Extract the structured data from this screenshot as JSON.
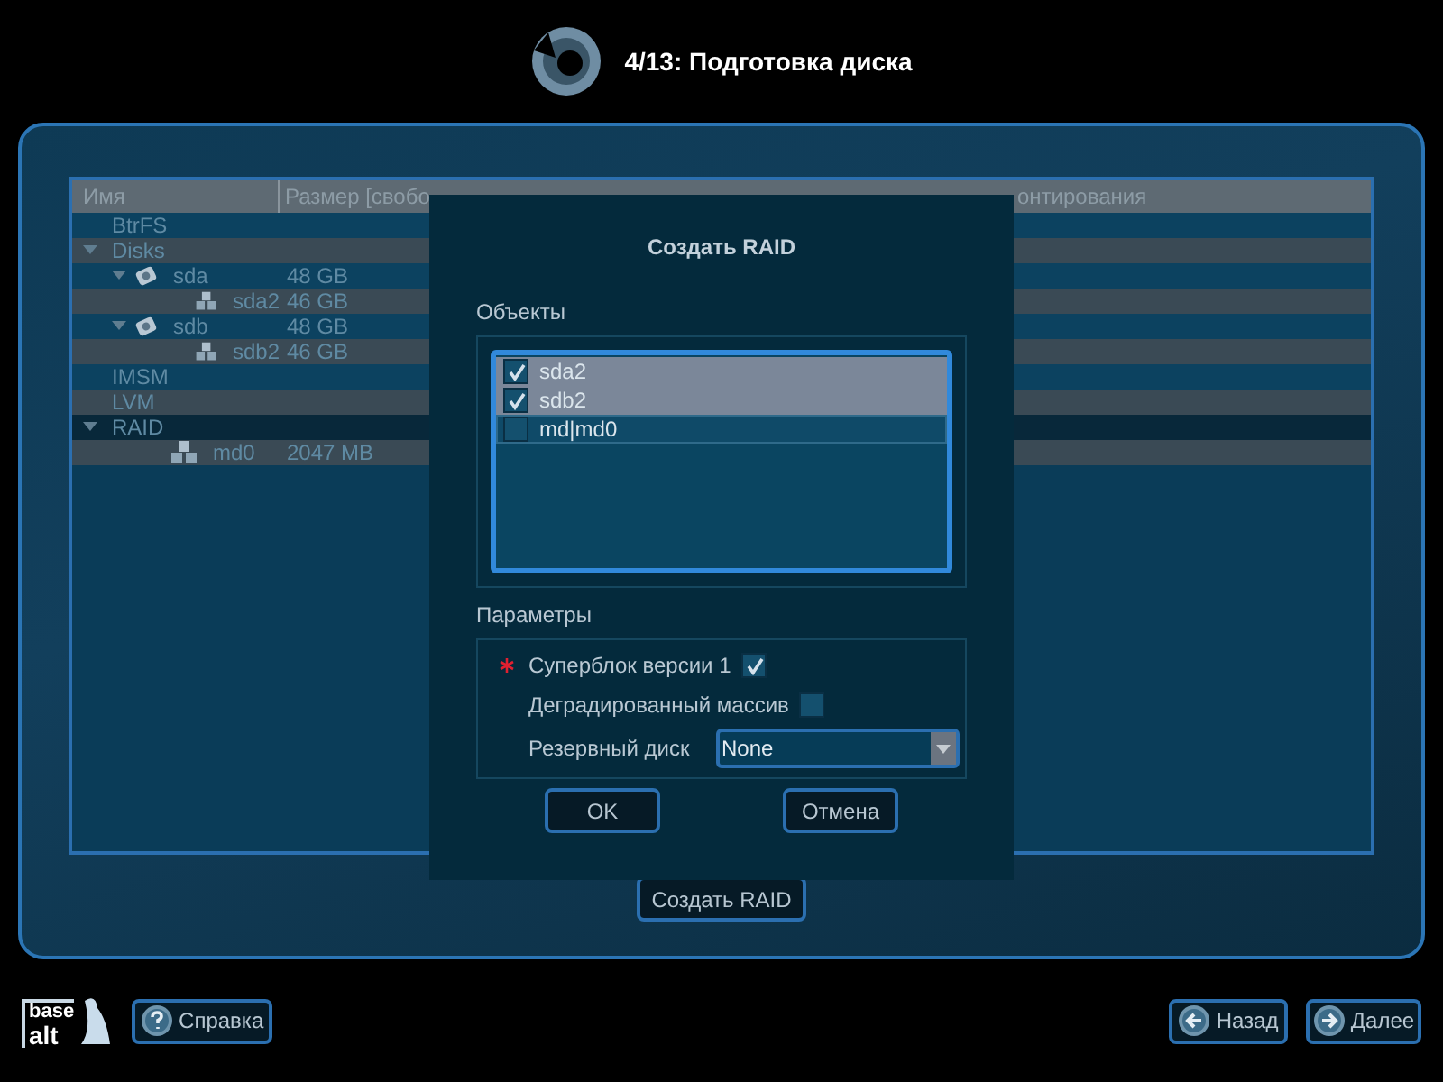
{
  "header": {
    "title": "4/13: Подготовка диска"
  },
  "table": {
    "columns": [
      "Имя",
      "Размер [свобо",
      "онтирования"
    ],
    "rows": [
      {
        "kind": "group",
        "name": "BtrFS",
        "selected": false
      },
      {
        "kind": "group",
        "name": "Disks",
        "selected": false,
        "expanded": true,
        "children": [
          {
            "kind": "disk",
            "name": "sda",
            "size": "48 GB",
            "selected": false,
            "expanded": true,
            "children": [
              {
                "kind": "partition",
                "name": "sda2",
                "size": "46 GB",
                "selected": false
              }
            ]
          },
          {
            "kind": "disk",
            "name": "sdb",
            "size": "48 GB",
            "selected": false,
            "expanded": true,
            "children": [
              {
                "kind": "partition",
                "name": "sdb2",
                "size": "46 GB",
                "selected": false
              }
            ]
          }
        ]
      },
      {
        "kind": "group",
        "name": "IMSM",
        "selected": false
      },
      {
        "kind": "group",
        "name": "LVM",
        "selected": false
      },
      {
        "kind": "group",
        "name": "RAID",
        "selected": true,
        "expanded": true,
        "children": [
          {
            "kind": "partition",
            "name": "md0",
            "size": "2047 MB",
            "selected": false
          }
        ]
      }
    ]
  },
  "create_raid_button": "Создать RAID",
  "dialog": {
    "title": "Создать RAID",
    "objects_label": "Объекты",
    "objects": [
      {
        "label": "sda2",
        "checked": true,
        "selected": false
      },
      {
        "label": "sdb2",
        "checked": true,
        "selected": false
      },
      {
        "label": "md|md0",
        "checked": false,
        "selected": true
      }
    ],
    "params_label": "Параметры",
    "params": [
      {
        "kind": "checkbox",
        "label": "Суперблок версии 1",
        "checked": true,
        "required": true
      },
      {
        "kind": "checkbox",
        "label": "Деградированный массив",
        "checked": false
      },
      {
        "kind": "select",
        "label": "Резервный диск",
        "value": "None"
      }
    ],
    "buttons": [
      "OK",
      "Отмена"
    ]
  },
  "footer": {
    "logo": {
      "top": "base",
      "bottom": "alt"
    },
    "help": "Справка",
    "back": "Назад",
    "next": "Далее"
  }
}
